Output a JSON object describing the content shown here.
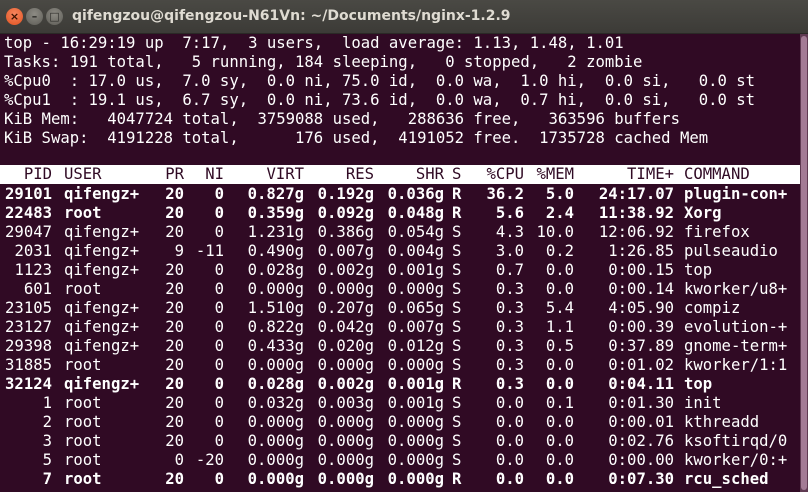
{
  "window": {
    "title": "qifengzou@qifengzou-N61Vn: ~/Documents/nginx-1.2.9",
    "buttons": {
      "close": "×",
      "minimize": "–",
      "maximize": "□"
    }
  },
  "summary": [
    "top - 16:29:19 up  7:17,  3 users,  load average: 1.13, 1.48, 1.01",
    "Tasks: 191 total,   5 running, 184 sleeping,   0 stopped,   2 zombie",
    "%Cpu0  : 17.0 us,  7.0 sy,  0.0 ni, 75.0 id,  0.0 wa,  1.0 hi,  0.0 si,   0.0 st",
    "%Cpu1  : 19.1 us,  6.7 sy,  0.0 ni, 73.6 id,  0.0 wa,  0.7 hi,  0.0 si,   0.0 st",
    "KiB Mem:   4047724 total,  3759088 used,   288636 free,   363596 buffers",
    "KiB Swap:  4191228 total,      176 used,  4191052 free.  1735728 cached Mem"
  ],
  "table": {
    "columns": [
      "PID",
      "USER",
      "PR",
      "NI",
      "VIRT",
      "RES",
      "SHR",
      "S",
      "%CPU",
      "%MEM",
      "TIME+",
      "COMMAND"
    ],
    "rows": [
      {
        "bold": true,
        "cells": [
          "29101",
          "qifengz+",
          "20",
          "0",
          "0.827g",
          "0.192g",
          "0.036g",
          "R",
          "36.2",
          "5.0",
          "24:17.07",
          "plugin-con+"
        ]
      },
      {
        "bold": true,
        "cells": [
          "22483",
          "root",
          "20",
          "0",
          "0.359g",
          "0.092g",
          "0.048g",
          "R",
          "5.6",
          "2.4",
          "11:38.92",
          "Xorg"
        ]
      },
      {
        "bold": false,
        "cells": [
          "29047",
          "qifengz+",
          "20",
          "0",
          "1.231g",
          "0.386g",
          "0.054g",
          "S",
          "4.3",
          "10.0",
          "12:06.92",
          "firefox"
        ]
      },
      {
        "bold": false,
        "cells": [
          "2031",
          "qifengz+",
          "9",
          "-11",
          "0.490g",
          "0.007g",
          "0.004g",
          "S",
          "3.0",
          "0.2",
          "1:26.85",
          "pulseaudio"
        ]
      },
      {
        "bold": false,
        "cells": [
          "1123",
          "qifengz+",
          "20",
          "0",
          "0.028g",
          "0.002g",
          "0.001g",
          "S",
          "0.7",
          "0.0",
          "0:00.15",
          "top"
        ]
      },
      {
        "bold": false,
        "cells": [
          "601",
          "root",
          "20",
          "0",
          "0.000g",
          "0.000g",
          "0.000g",
          "S",
          "0.3",
          "0.0",
          "0:00.14",
          "kworker/u8+"
        ]
      },
      {
        "bold": false,
        "cells": [
          "23105",
          "qifengz+",
          "20",
          "0",
          "1.510g",
          "0.207g",
          "0.065g",
          "S",
          "0.3",
          "5.4",
          "4:05.90",
          "compiz"
        ]
      },
      {
        "bold": false,
        "cells": [
          "23127",
          "qifengz+",
          "20",
          "0",
          "0.822g",
          "0.042g",
          "0.007g",
          "S",
          "0.3",
          "1.1",
          "0:00.39",
          "evolution-+"
        ]
      },
      {
        "bold": false,
        "cells": [
          "29398",
          "qifengz+",
          "20",
          "0",
          "0.433g",
          "0.020g",
          "0.012g",
          "S",
          "0.3",
          "0.5",
          "0:37.89",
          "gnome-term+"
        ]
      },
      {
        "bold": false,
        "cells": [
          "31885",
          "root",
          "20",
          "0",
          "0.000g",
          "0.000g",
          "0.000g",
          "S",
          "0.3",
          "0.0",
          "0:01.02",
          "kworker/1:1"
        ]
      },
      {
        "bold": true,
        "cells": [
          "32124",
          "qifengz+",
          "20",
          "0",
          "0.028g",
          "0.002g",
          "0.001g",
          "R",
          "0.3",
          "0.0",
          "0:04.11",
          "top"
        ]
      },
      {
        "bold": false,
        "cells": [
          "1",
          "root",
          "20",
          "0",
          "0.032g",
          "0.003g",
          "0.001g",
          "S",
          "0.0",
          "0.1",
          "0:01.30",
          "init"
        ]
      },
      {
        "bold": false,
        "cells": [
          "2",
          "root",
          "20",
          "0",
          "0.000g",
          "0.000g",
          "0.000g",
          "S",
          "0.0",
          "0.0",
          "0:00.01",
          "kthreadd"
        ]
      },
      {
        "bold": false,
        "cells": [
          "3",
          "root",
          "20",
          "0",
          "0.000g",
          "0.000g",
          "0.000g",
          "S",
          "0.0",
          "0.0",
          "0:02.76",
          "ksoftirqd/0"
        ]
      },
      {
        "bold": false,
        "cells": [
          "5",
          "root",
          "0",
          "-20",
          "0.000g",
          "0.000g",
          "0.000g",
          "S",
          "0.0",
          "0.0",
          "0:00.00",
          "kworker/0:+"
        ]
      },
      {
        "bold": true,
        "cells": [
          "7",
          "root",
          "20",
          "0",
          "0.000g",
          "0.000g",
          "0.000g",
          "R",
          "0.0",
          "0.0",
          "0:07.30",
          "rcu_sched"
        ]
      }
    ]
  }
}
